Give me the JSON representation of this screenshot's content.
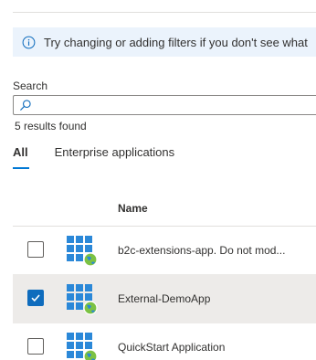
{
  "info_bar": {
    "icon": "info-icon",
    "message": "Try changing or adding filters if you don't see what"
  },
  "search": {
    "label": "Search",
    "value": "",
    "placeholder": "",
    "icon": "search-icon"
  },
  "results": {
    "summary": "5 results found"
  },
  "tabs": [
    {
      "label": "All",
      "active": true
    },
    {
      "label": "Enterprise applications",
      "active": false
    }
  ],
  "table": {
    "columns": {
      "name": "Name"
    },
    "rows": [
      {
        "name": "b2c-extensions-app. Do not mod...",
        "selected": false,
        "icon": "app-grid-globe-icon"
      },
      {
        "name": "External-DemoApp",
        "selected": true,
        "icon": "app-grid-globe-icon"
      },
      {
        "name": "QuickStart Application",
        "selected": false,
        "icon": "app-grid-globe-icon"
      }
    ]
  },
  "colors": {
    "accent": "#0078d4",
    "info_bg": "#ebf3fc",
    "selected_row": "#edebe9",
    "checkbox_checked": "#0f6cbd",
    "app_tile": "#2b88d8",
    "globe": "#7cc243"
  }
}
